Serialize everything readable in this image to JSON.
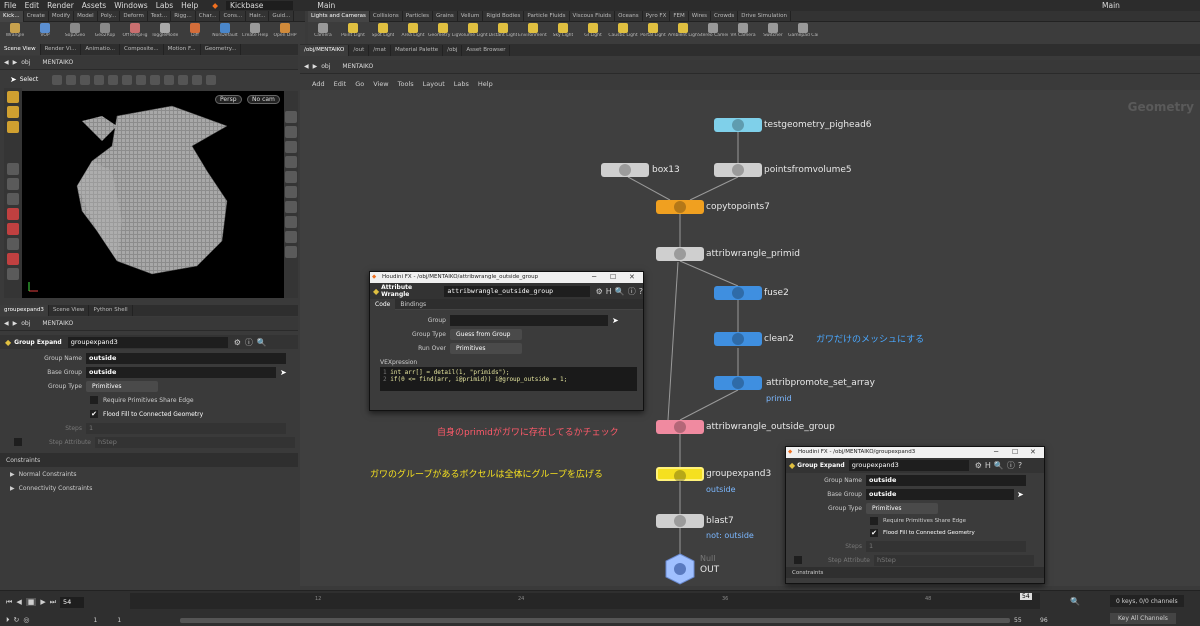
{
  "menubar": {
    "items": [
      "File",
      "Edit",
      "Render",
      "Assets",
      "Windows",
      "Labs",
      "Help"
    ],
    "desktop": "Kickbase",
    "desk_main": "Main",
    "right_main": "Main"
  },
  "shelf_left": {
    "tabs": [
      "Kick...",
      "Create",
      "Modify",
      "Model",
      "Poly...",
      "Deform",
      "Text...",
      "Rigg...",
      "Char...",
      "Cons...",
      "Hair...",
      "Guid..."
    ],
    "tools": [
      {
        "label": "Wrangle",
        "color": "#c7a14d"
      },
      {
        "label": "VOP",
        "color": "#5b8fd1"
      },
      {
        "label": "Sop2Geo",
        "color": "#8a8a8a"
      },
      {
        "label": "Geo2Rop",
        "color": "#8a8a8a"
      },
      {
        "label": "OffTempFig",
        "color": "#c96f6f"
      },
      {
        "label": "ToggleMode",
        "color": "#aaaaaa"
      },
      {
        "label": "Diff",
        "color": "#d36d3a"
      },
      {
        "label": "NonDefault",
        "color": "#4a86c9"
      },
      {
        "label": "Create Help",
        "color": "#9a9a9a"
      },
      {
        "label": "Open DHP",
        "color": "#d08a3a"
      }
    ]
  },
  "shelf_right": {
    "tabs": [
      "Lights and Cameras",
      "Collisions",
      "Particles",
      "Grains",
      "Vellum",
      "Rigid Bodies",
      "Particle Fluids",
      "Viscous Fluids",
      "Oceans",
      "Pyro FX",
      "FEM",
      "Wires",
      "Crowds",
      "Drive Simulation"
    ],
    "tools": [
      {
        "label": "Camera",
        "color": "#999999"
      },
      {
        "label": "Point Light",
        "color": "#e0c040"
      },
      {
        "label": "Spot Light",
        "color": "#e0c040"
      },
      {
        "label": "Area Light",
        "color": "#e0c040"
      },
      {
        "label": "Geometry Light",
        "color": "#e0c040"
      },
      {
        "label": "Volume Light",
        "color": "#e0c040"
      },
      {
        "label": "Distant Light",
        "color": "#e0c040"
      },
      {
        "label": "Environment Light",
        "color": "#e0c040"
      },
      {
        "label": "Sky Light",
        "color": "#e0c040"
      },
      {
        "label": "GI Light",
        "color": "#e0c040"
      },
      {
        "label": "Caustic Light",
        "color": "#e0c040"
      },
      {
        "label": "Portal Light",
        "color": "#e0c040"
      },
      {
        "label": "Ambient Light",
        "color": "#e0c040"
      },
      {
        "label": "Stereo Camera",
        "color": "#999999"
      },
      {
        "label": "VR Camera",
        "color": "#999999"
      },
      {
        "label": "Switcher",
        "color": "#999999"
      },
      {
        "label": "Gamepad Camera",
        "color": "#999999"
      }
    ]
  },
  "scene_tabs": [
    "Scene View",
    "Render Vi...",
    "Animatio...",
    "Composite...",
    "Motion F...",
    "Geometry..."
  ],
  "scene_path": {
    "obj": "obj",
    "node": "MENTAIKO"
  },
  "viewport": {
    "select_label": "Select",
    "persp": "Persp",
    "cam": "No cam"
  },
  "network_tabs": [
    "/obj/MENTAIKO",
    "/out",
    "/mat",
    "Material Palette",
    "/obj",
    "Asset Browser"
  ],
  "network_path": {
    "obj": "obj",
    "node": "MENTAIKO"
  },
  "network_menu": [
    "Add",
    "Edit",
    "Go",
    "View",
    "Tools",
    "Layout",
    "Labs",
    "Help"
  ],
  "network_context": "Geometry",
  "nodes": [
    {
      "name": "testgeometry_pighead6",
      "color": "#7fd0ea"
    },
    {
      "name": "box13",
      "color": "#cfcfcf"
    },
    {
      "name": "pointsfromvolume5",
      "color": "#cfcfcf"
    },
    {
      "name": "copytopoints7",
      "color": "#f0a020"
    },
    {
      "name": "attribwrangle_primid",
      "color": "#cfcfcf"
    },
    {
      "name": "fuse2",
      "color": "#3f8fe0"
    },
    {
      "name": "clean2",
      "color": "#3f8fe0"
    },
    {
      "name": "attribpromote_set_array",
      "color": "#3f8fe0",
      "sub": "primid"
    },
    {
      "name": "attribwrangle_outside_group",
      "color": "#f08aa0"
    },
    {
      "name": "groupexpand3",
      "color": "#f5e020",
      "sub": "outside"
    },
    {
      "name": "blast7",
      "color": "#cfcfcf",
      "sub": "not: outside"
    },
    {
      "name": "OUT",
      "color": "#a0c0ff",
      "sub_top": "Null"
    }
  ],
  "annotations": {
    "clean_note": "ガワだけのメッシュにする",
    "primid_note": "自身のprimidがガワに存在してるかチェック",
    "group_note": "ガワのグループがあるボクセルは全体にグループを広げる"
  },
  "param_tabs": [
    "groupexpand3",
    "Scene View",
    "Python Shell"
  ],
  "param_path": {
    "obj": "obj",
    "node": "MENTAIKO"
  },
  "params": {
    "type": "Group Expand",
    "name": "groupexpand3",
    "group_name_label": "Group Name",
    "group_name": "outside",
    "base_group_label": "Base Group",
    "base_group": "outside",
    "group_type_label": "Group Type",
    "group_type": "Primitives",
    "share_edge": "Require Primitives Share Edge",
    "flood_fill": "Flood Fill to Connected Geometry",
    "steps_label": "Steps",
    "steps": "1",
    "step_attr_label": "Step Attribute",
    "step_attr": "hStep",
    "constraints": "Constraints",
    "normal_constraints": "Normal Constraints",
    "connectivity_constraints": "Connectivity Constraints"
  },
  "wrangle_window": {
    "title": "Houdini FX - /obj/MENTAIKO/attribwrangle_outside_group",
    "type": "Attribute Wrangle",
    "name": "attribwrangle_outside_group",
    "tab_code": "Code",
    "tab_bindings": "Bindings",
    "group_label": "Group",
    "group_type_label": "Group Type",
    "group_type": "Guess from Group",
    "run_over_label": "Run Over",
    "run_over": "Primitives",
    "vex_label": "VEXpression",
    "code_line1": "int arr[] = detail(1, \"primids\");",
    "code_line2": "if(0 <= find(arr, i@primid)) i@group_outside = 1;"
  },
  "group_window": {
    "title": "Houdini FX - /obj/MENTAIKO/groupexpand3",
    "type": "Group Expand",
    "name": "groupexpand3",
    "group_name_label": "Group Name",
    "group_name": "outside",
    "base_group_label": "Base Group",
    "base_group": "outside",
    "group_type_label": "Group Type",
    "group_type": "Primitives",
    "share_edge": "Require Primitives Share Edge",
    "flood_fill": "Flood Fill to Connected Geometry",
    "steps_label": "Steps",
    "steps": "1",
    "step_attr_label": "Step Attribute",
    "step_attr": "hStep",
    "constraints": "Constraints"
  },
  "timeline": {
    "frame": "54",
    "start": "1",
    "start2": "1",
    "end": "55",
    "end2": "96",
    "marker": "54",
    "keys": "0 keys, 0/0 channels",
    "key_all": "Key All Channels",
    "ticks": [
      "12",
      "24",
      "36",
      "48"
    ]
  }
}
